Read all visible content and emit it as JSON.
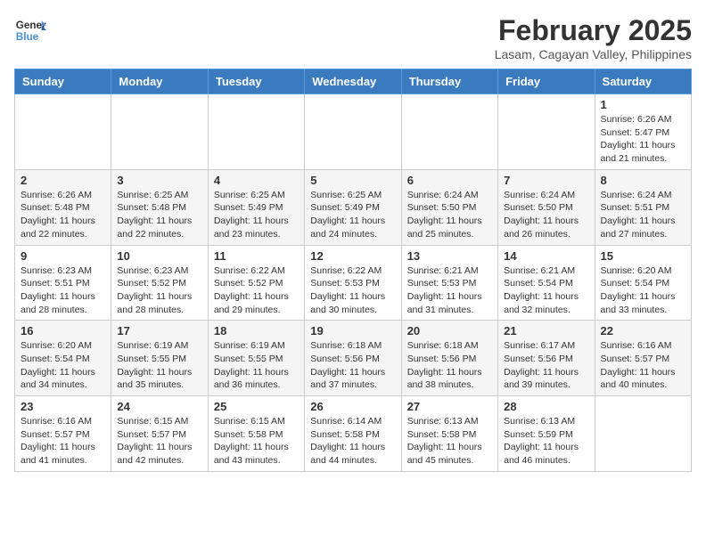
{
  "header": {
    "logo_line1": "General",
    "logo_line2": "Blue",
    "month_year": "February 2025",
    "location": "Lasam, Cagayan Valley, Philippines"
  },
  "weekdays": [
    "Sunday",
    "Monday",
    "Tuesday",
    "Wednesday",
    "Thursday",
    "Friday",
    "Saturday"
  ],
  "weeks": [
    [
      {
        "day": "",
        "info": ""
      },
      {
        "day": "",
        "info": ""
      },
      {
        "day": "",
        "info": ""
      },
      {
        "day": "",
        "info": ""
      },
      {
        "day": "",
        "info": ""
      },
      {
        "day": "",
        "info": ""
      },
      {
        "day": "1",
        "info": "Sunrise: 6:26 AM\nSunset: 5:47 PM\nDaylight: 11 hours and 21 minutes."
      }
    ],
    [
      {
        "day": "2",
        "info": "Sunrise: 6:26 AM\nSunset: 5:48 PM\nDaylight: 11 hours and 22 minutes."
      },
      {
        "day": "3",
        "info": "Sunrise: 6:25 AM\nSunset: 5:48 PM\nDaylight: 11 hours and 22 minutes."
      },
      {
        "day": "4",
        "info": "Sunrise: 6:25 AM\nSunset: 5:49 PM\nDaylight: 11 hours and 23 minutes."
      },
      {
        "day": "5",
        "info": "Sunrise: 6:25 AM\nSunset: 5:49 PM\nDaylight: 11 hours and 24 minutes."
      },
      {
        "day": "6",
        "info": "Sunrise: 6:24 AM\nSunset: 5:50 PM\nDaylight: 11 hours and 25 minutes."
      },
      {
        "day": "7",
        "info": "Sunrise: 6:24 AM\nSunset: 5:50 PM\nDaylight: 11 hours and 26 minutes."
      },
      {
        "day": "8",
        "info": "Sunrise: 6:24 AM\nSunset: 5:51 PM\nDaylight: 11 hours and 27 minutes."
      }
    ],
    [
      {
        "day": "9",
        "info": "Sunrise: 6:23 AM\nSunset: 5:51 PM\nDaylight: 11 hours and 28 minutes."
      },
      {
        "day": "10",
        "info": "Sunrise: 6:23 AM\nSunset: 5:52 PM\nDaylight: 11 hours and 28 minutes."
      },
      {
        "day": "11",
        "info": "Sunrise: 6:22 AM\nSunset: 5:52 PM\nDaylight: 11 hours and 29 minutes."
      },
      {
        "day": "12",
        "info": "Sunrise: 6:22 AM\nSunset: 5:53 PM\nDaylight: 11 hours and 30 minutes."
      },
      {
        "day": "13",
        "info": "Sunrise: 6:21 AM\nSunset: 5:53 PM\nDaylight: 11 hours and 31 minutes."
      },
      {
        "day": "14",
        "info": "Sunrise: 6:21 AM\nSunset: 5:54 PM\nDaylight: 11 hours and 32 minutes."
      },
      {
        "day": "15",
        "info": "Sunrise: 6:20 AM\nSunset: 5:54 PM\nDaylight: 11 hours and 33 minutes."
      }
    ],
    [
      {
        "day": "16",
        "info": "Sunrise: 6:20 AM\nSunset: 5:54 PM\nDaylight: 11 hours and 34 minutes."
      },
      {
        "day": "17",
        "info": "Sunrise: 6:19 AM\nSunset: 5:55 PM\nDaylight: 11 hours and 35 minutes."
      },
      {
        "day": "18",
        "info": "Sunrise: 6:19 AM\nSunset: 5:55 PM\nDaylight: 11 hours and 36 minutes."
      },
      {
        "day": "19",
        "info": "Sunrise: 6:18 AM\nSunset: 5:56 PM\nDaylight: 11 hours and 37 minutes."
      },
      {
        "day": "20",
        "info": "Sunrise: 6:18 AM\nSunset: 5:56 PM\nDaylight: 11 hours and 38 minutes."
      },
      {
        "day": "21",
        "info": "Sunrise: 6:17 AM\nSunset: 5:56 PM\nDaylight: 11 hours and 39 minutes."
      },
      {
        "day": "22",
        "info": "Sunrise: 6:16 AM\nSunset: 5:57 PM\nDaylight: 11 hours and 40 minutes."
      }
    ],
    [
      {
        "day": "23",
        "info": "Sunrise: 6:16 AM\nSunset: 5:57 PM\nDaylight: 11 hours and 41 minutes."
      },
      {
        "day": "24",
        "info": "Sunrise: 6:15 AM\nSunset: 5:57 PM\nDaylight: 11 hours and 42 minutes."
      },
      {
        "day": "25",
        "info": "Sunrise: 6:15 AM\nSunset: 5:58 PM\nDaylight: 11 hours and 43 minutes."
      },
      {
        "day": "26",
        "info": "Sunrise: 6:14 AM\nSunset: 5:58 PM\nDaylight: 11 hours and 44 minutes."
      },
      {
        "day": "27",
        "info": "Sunrise: 6:13 AM\nSunset: 5:58 PM\nDaylight: 11 hours and 45 minutes."
      },
      {
        "day": "28",
        "info": "Sunrise: 6:13 AM\nSunset: 5:59 PM\nDaylight: 11 hours and 46 minutes."
      },
      {
        "day": "",
        "info": ""
      }
    ]
  ]
}
